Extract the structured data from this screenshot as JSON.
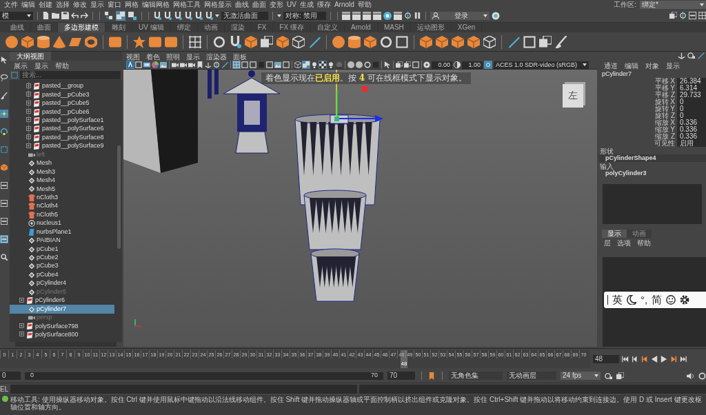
{
  "menu_bar": {
    "items": [
      "文件",
      "编辑",
      "创建",
      "选择",
      "修改",
      "显示",
      "窗口",
      "网格",
      "编辑网格",
      "网格工具",
      "网格显示",
      "曲线",
      "曲面",
      "变形",
      "UV",
      "生成",
      "缓存",
      "Arnold",
      "帮助"
    ],
    "workspace_label": "工作区:",
    "workspace": "绑定*"
  },
  "status_line": {
    "mode": "模",
    "select_modes": [
      {
        "kind": "hierarchy",
        "selected": false
      },
      {
        "kind": "object",
        "selected": true
      },
      {
        "kind": "component",
        "selected": false
      }
    ],
    "live_surface": "无激活曲面",
    "symmetry": "对称: 禁用",
    "login": "登录"
  },
  "shelf": {
    "tabs": [
      {
        "label": "曲线",
        "selected": false
      },
      {
        "label": "曲面",
        "selected": false
      },
      {
        "label": "多边形建模",
        "selected": true
      },
      {
        "label": "雕刻",
        "selected": false
      },
      {
        "label": "UV 编辑",
        "selected": false
      },
      {
        "label": "绑定",
        "selected": false
      },
      {
        "label": "动画",
        "selected": false
      },
      {
        "label": "渲染",
        "selected": false
      },
      {
        "label": "FX",
        "selected": false
      },
      {
        "label": "FX 缓存",
        "selected": false
      },
      {
        "label": "自定义",
        "selected": false
      },
      {
        "label": "Arnold",
        "selected": false
      },
      {
        "label": "MASH",
        "selected": false
      },
      {
        "label": "运动图形",
        "selected": false
      },
      {
        "label": "XGen",
        "selected": false
      }
    ]
  },
  "toolbox": [
    {
      "kind": "pointer",
      "selected": false
    },
    {
      "kind": "lasso",
      "selected": false
    },
    {
      "kind": "brush",
      "selected": false
    },
    {
      "kind": "move",
      "selected": true
    },
    {
      "kind": "rotate",
      "selected": false
    },
    {
      "kind": "scale",
      "selected": false
    },
    {
      "kind": "cube",
      "selected": false
    },
    {
      "kind": "layout",
      "selected": false
    },
    {
      "kind": "layout",
      "selected": false
    },
    {
      "kind": "layout",
      "selected": false
    },
    {
      "kind": "layout",
      "selected": true
    },
    {
      "kind": "search",
      "selected": false
    }
  ],
  "outliner": {
    "title": "大纲视图",
    "menu": [
      "展示",
      "显示",
      "帮助"
    ],
    "search_placeholder": "搜索...",
    "items": [
      {
        "children": [
          {
            "label": "pasted__group",
            "kind": "group",
            "hidden": false,
            "selected": false
          },
          {
            "label": "pasted__pCube3",
            "kind": "group",
            "hidden": false,
            "selected": false
          },
          {
            "label": "pasted__pCube5",
            "kind": "group",
            "hidden": false,
            "selected": false
          },
          {
            "label": "pasted__pCube6",
            "kind": "group",
            "hidden": false,
            "selected": false
          },
          {
            "label": "pasted__polySurface1",
            "kind": "group",
            "hidden": false,
            "selected": false
          },
          {
            "label": "pasted__polySurface6",
            "kind": "group",
            "hidden": false,
            "selected": false
          },
          {
            "label": "pasted__polySurface8",
            "kind": "group",
            "hidden": false,
            "selected": false
          },
          {
            "label": "pasted__polySurface9",
            "kind": "group",
            "hidden": false,
            "selected": false
          }
        ]
      },
      {
        "label": "left",
        "kind": "camera",
        "hidden": true,
        "selected": false
      },
      {
        "label": "Mesh",
        "kind": "mesh",
        "hidden": false,
        "selected": false
      },
      {
        "label": "Mesh3",
        "kind": "mesh",
        "hidden": false,
        "selected": false
      },
      {
        "label": "Mesh4",
        "kind": "mesh",
        "hidden": false,
        "selected": false
      },
      {
        "label": "Mesh5",
        "kind": "mesh",
        "hidden": false,
        "selected": false
      },
      {
        "label": "nCloth3",
        "kind": "cloth",
        "hidden": false,
        "selected": false
      },
      {
        "label": "nCloth4",
        "kind": "cloth",
        "hidden": false,
        "selected": false
      },
      {
        "label": "nCloth5",
        "kind": "cloth",
        "hidden": false,
        "selected": false
      },
      {
        "label": "nucleus1",
        "kind": "nucleus",
        "hidden": false,
        "selected": false
      },
      {
        "label": "nurbsPlane1",
        "kind": "nurbs",
        "hidden": false,
        "selected": false
      },
      {
        "label": "PAIBIAN",
        "kind": "mesh",
        "hidden": false,
        "selected": false
      },
      {
        "label": "pCube1",
        "kind": "mesh",
        "hidden": false,
        "selected": false
      },
      {
        "label": "pCube2",
        "kind": "mesh",
        "hidden": false,
        "selected": false
      },
      {
        "label": "pCube3",
        "kind": "mesh",
        "hidden": false,
        "selected": false
      },
      {
        "label": "pCube4",
        "kind": "mesh",
        "hidden": false,
        "selected": false
      },
      {
        "label": "pCylinder4",
        "kind": "mesh",
        "hidden": false,
        "selected": false
      },
      {
        "label": "pCylinder5",
        "kind": "mesh",
        "hidden": true,
        "selected": false
      },
      {
        "label": "pCylinder6",
        "kind": "group",
        "hidden": false,
        "selected": false
      },
      {
        "label": "pCylinder7",
        "kind": "mesh",
        "hidden": false,
        "selected": true
      },
      {
        "label": "persp",
        "kind": "camera",
        "hidden": true,
        "selected": false
      },
      {
        "label": "polySurface798",
        "kind": "group",
        "hidden": false,
        "selected": false
      },
      {
        "label": "polySurface800",
        "kind": "group",
        "hidden": false,
        "selected": false
      }
    ]
  },
  "viewport": {
    "menu": [
      "视图",
      "着色",
      "照明",
      "显示",
      "渲染器",
      "面板"
    ],
    "toolbar": [
      [
        {
          "kind": "select-camera",
          "selected": true
        },
        {
          "kind": "frame",
          "selected": false
        },
        {
          "kind": "film",
          "selected": false
        },
        {
          "kind": "color-wheel",
          "selected": false
        },
        {
          "kind": "image",
          "selected": false
        }
      ],
      [
        {
          "kind": "camera",
          "selected": false
        },
        {
          "kind": "camera",
          "selected": false
        },
        {
          "kind": "camera",
          "selected": false
        },
        {
          "kind": "bookmark",
          "selected": false
        },
        {
          "kind": "axes",
          "selected": false
        },
        {
          "kind": "pivot",
          "selected": false
        },
        {
          "kind": "pen",
          "selected": false
        }
      ],
      [
        {
          "kind": "grid",
          "selected": true
        },
        {
          "kind": "frame",
          "selected": false
        },
        {
          "kind": "frame",
          "selected": false
        },
        {
          "kind": "square",
          "selected": false
        },
        {
          "kind": "frame",
          "selected": false
        },
        {
          "kind": "image",
          "selected": false
        },
        {
          "kind": "frame",
          "selected": false
        }
      ],
      [
        {
          "kind": "wire-cube",
          "selected": false
        },
        {
          "kind": "cube",
          "selected": true
        },
        {
          "kind": "light",
          "selected": false
        },
        {
          "kind": "checker",
          "selected": true
        },
        {
          "kind": "light",
          "selected": false
        },
        {
          "kind": "shadow",
          "selected": false
        }
      ],
      [
        {
          "kind": "sphere",
          "selected": false
        },
        {
          "kind": "sphere",
          "selected": false
        },
        {
          "kind": "ring",
          "selected": false
        },
        {
          "kind": "square",
          "selected": false
        }
      ],
      [
        {
          "kind": "pointer",
          "selected": false
        }
      ],
      [
        {
          "kind": "layers",
          "selected": false
        },
        {
          "kind": "layers",
          "selected": false
        },
        {
          "kind": "frame",
          "selected": false
        }
      ]
    ],
    "exposure": "0.00",
    "gamma": "1.00",
    "color_management": true,
    "color_space": "ACES 1.0 SDR-video (sRGB)",
    "message": "着色显示现在**已启用**。按 **4** 可在线框模式下显示对象。",
    "view_cube": "左"
  },
  "channel_box": {
    "menu": [
      "通道",
      "编辑",
      "对象",
      "显示"
    ],
    "object": "pCylinder7",
    "attributes": [
      {
        "label": "平移 X",
        "value": "26.384"
      },
      {
        "label": "平移 Y",
        "value": "6.314"
      },
      {
        "label": "平移 Z",
        "value": "29.733"
      },
      {
        "label": "旋转 X",
        "value": "0"
      },
      {
        "label": "旋转 Y",
        "value": "0"
      },
      {
        "label": "旋转 Z",
        "value": "0"
      },
      {
        "label": "缩放 X",
        "value": "0.336"
      },
      {
        "label": "缩放 Y",
        "value": "0.336"
      },
      {
        "label": "缩放 Z",
        "value": "0.336"
      },
      {
        "label": "可见性",
        "value": "启用"
      }
    ],
    "shapes_heading": "形状",
    "shape": "pCylinderShape4",
    "inputs_heading": "输入",
    "input": "polyCylinder3"
  },
  "layer_editor": {
    "tabs": [
      {
        "label": "显示",
        "selected": true
      },
      {
        "label": "动画",
        "selected": false
      }
    ],
    "menu": [
      "层",
      "选项",
      "帮助"
    ]
  },
  "ime_bar": {
    "language": "英",
    "punctuation": "°,",
    "script": "简"
  },
  "timeline": {
    "ticks": [
      "0",
      "1",
      "2",
      "3",
      "4",
      "5",
      "6",
      "7",
      "8",
      "9",
      "10",
      "11",
      "12",
      "13",
      "14",
      "15",
      "16",
      "17",
      "18",
      "19",
      "20",
      "21",
      "22",
      "23",
      "24",
      "25",
      "26",
      "27",
      "28",
      "29",
      "30",
      "31",
      "32",
      "33",
      "34",
      "35",
      "36",
      "37",
      "38",
      "39",
      "40",
      "41",
      "42",
      "43",
      "44",
      "45",
      "46",
      "47",
      "48",
      "49",
      "50",
      "51",
      "52",
      "53",
      "54",
      "55",
      "56",
      "57",
      "58",
      "59",
      "60",
      "61",
      "62",
      "63",
      "64",
      "65",
      "66",
      "67",
      "68",
      "69",
      "70"
    ],
    "playhead": {
      "label": "48",
      "level": 0.683
    },
    "current_frame": "48"
  },
  "range_slider": {
    "start": "0",
    "range_start": "0",
    "range_end": "70",
    "end": "70",
    "character_set": "无角色集",
    "anim_layer": "无动画层",
    "fps": "24 fps"
  },
  "command_line": {
    "label": "EL"
  },
  "help_line": "移动工具: 使用操纵器移动对象。按住 Ctrl 键并使用鼠标中键拖动以沿法线移动组件。按住 Shift 键并拖动操纵器轴或平面控制柄以挤出组件或克隆对象。按住 Ctrl+Shift 键并拖动以将移动约束到连接边。使用 D 或 Insert 键更改枢轴位置和轴方向。"
}
